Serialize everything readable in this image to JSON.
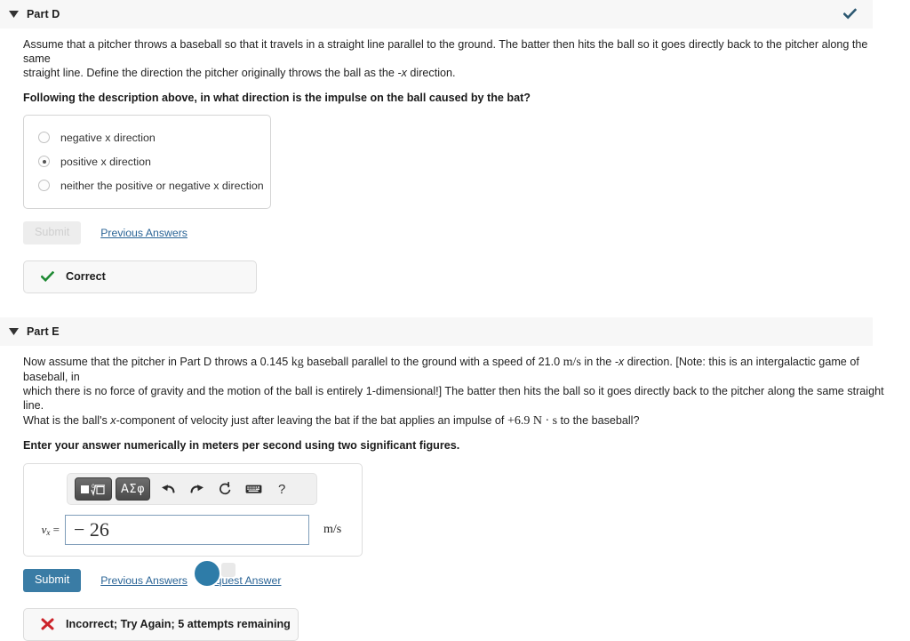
{
  "colors": {
    "header_band": "#f7f7f7",
    "header_check": "#2c5871",
    "submit_blue": "#3a7ca5",
    "link_blue": "#2a6496",
    "correct_green": "#1f8a34",
    "incorrect_red": "#cc2229",
    "input_border": "#7f9db9"
  },
  "part_d": {
    "title": "Part D",
    "caret_icon": "chevron-down-icon",
    "status_icon": "checkmark-icon",
    "prompt_line1": "Assume that a pitcher throws a baseball so that it travels in a straight line parallel to the ground. The batter then hits the ball so it goes directly back to the pitcher along the same",
    "prompt_line2_a": "straight line. Define the direction the pitcher originally throws the ball as the ",
    "prompt_line2_var": "-x",
    "prompt_line2_b": " direction.",
    "question": "Following the description above, in what direction is the impulse on the ball caused by the bat?",
    "choices": [
      {
        "label": "negative x direction",
        "selected": false
      },
      {
        "label": "positive x direction",
        "selected": true
      },
      {
        "label": "neither the positive or negative x direction",
        "selected": false
      }
    ],
    "submit_label": "Submit",
    "submit_disabled": true,
    "previous_answers_label": "Previous Answers",
    "feedback_text": "Correct",
    "feedback_icon": "check-icon"
  },
  "part_e": {
    "title": "Part E",
    "caret_icon": "chevron-down-icon",
    "prompt_l1_a": "Now assume that the pitcher in Part D throws a 0.145 ",
    "prompt_l1_mass_unit": "kg",
    "prompt_l1_b": " baseball parallel to the ground with a speed of 21.0 ",
    "prompt_l1_speed_unit": "m/s",
    "prompt_l1_c": " in the ",
    "prompt_l1_dir": "-x",
    "prompt_l1_d": " direction. [Note: this is an intergalactic game of baseball, in",
    "prompt_l2": "which there is no force of gravity and the motion of the ball is entirely 1-dimensional!] The batter then hits the ball so it goes directly back to the pitcher along the same straight line.",
    "prompt_l3_a": "What is the ball's ",
    "prompt_l3_var": "x",
    "prompt_l3_b": "-component of velocity just after leaving the bat if the bat applies an impulse of ",
    "prompt_l3_impulse": "+6.9 N · s",
    "prompt_l3_c": " to the baseball?",
    "question": "Enter your answer numerically in meters per second using two significant figures.",
    "toolbar": {
      "template_button": {
        "name": "math-template-button",
        "glyph": "■ⁿ√□"
      },
      "greek_button": {
        "name": "greek-symbols-button",
        "label": "ΑΣφ"
      },
      "undo": "undo-icon",
      "redo": "redo-icon",
      "reset": "reset-icon",
      "keyboard": "keyboard-icon",
      "help": "?"
    },
    "answer_label_var": "v",
    "answer_label_sub": "x",
    "answer_label_eq": " =",
    "answer_value": "− 26",
    "answer_unit": "m/s",
    "submit_label": "Submit",
    "previous_answers_label": "Previous Answers",
    "request_answer_label": "Request Answer",
    "feedback_text": "Incorrect; Try Again; 5 attempts remaining",
    "feedback_icon": "x-icon"
  }
}
